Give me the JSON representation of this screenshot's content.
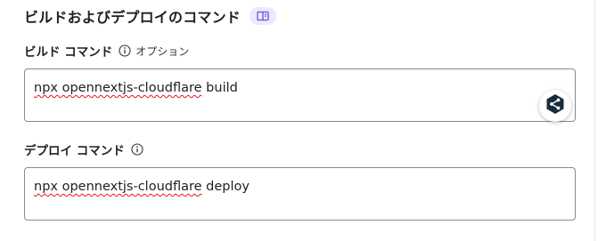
{
  "section": {
    "title": "ビルドおよびデプロイのコマンド",
    "docs_icon": "book-icon"
  },
  "build": {
    "label": "ビルド コマンド",
    "optional": "オプション",
    "info_icon": "info-icon",
    "value_misspelled": "npx opennextjs-cloudflare",
    "value_rest": " build"
  },
  "deploy": {
    "label": "デプロイ コマンド",
    "info_icon": "info-icon",
    "value_misspelled": "npx opennextjs-cloudflare",
    "value_rest": " deploy"
  },
  "extension": {
    "icon": "share-node-icon",
    "color": "#1b2b3c"
  },
  "colors": {
    "accent_badge": "#ece8ff",
    "accent_icon": "#6b55d6",
    "spellcheck": "#e81123"
  }
}
